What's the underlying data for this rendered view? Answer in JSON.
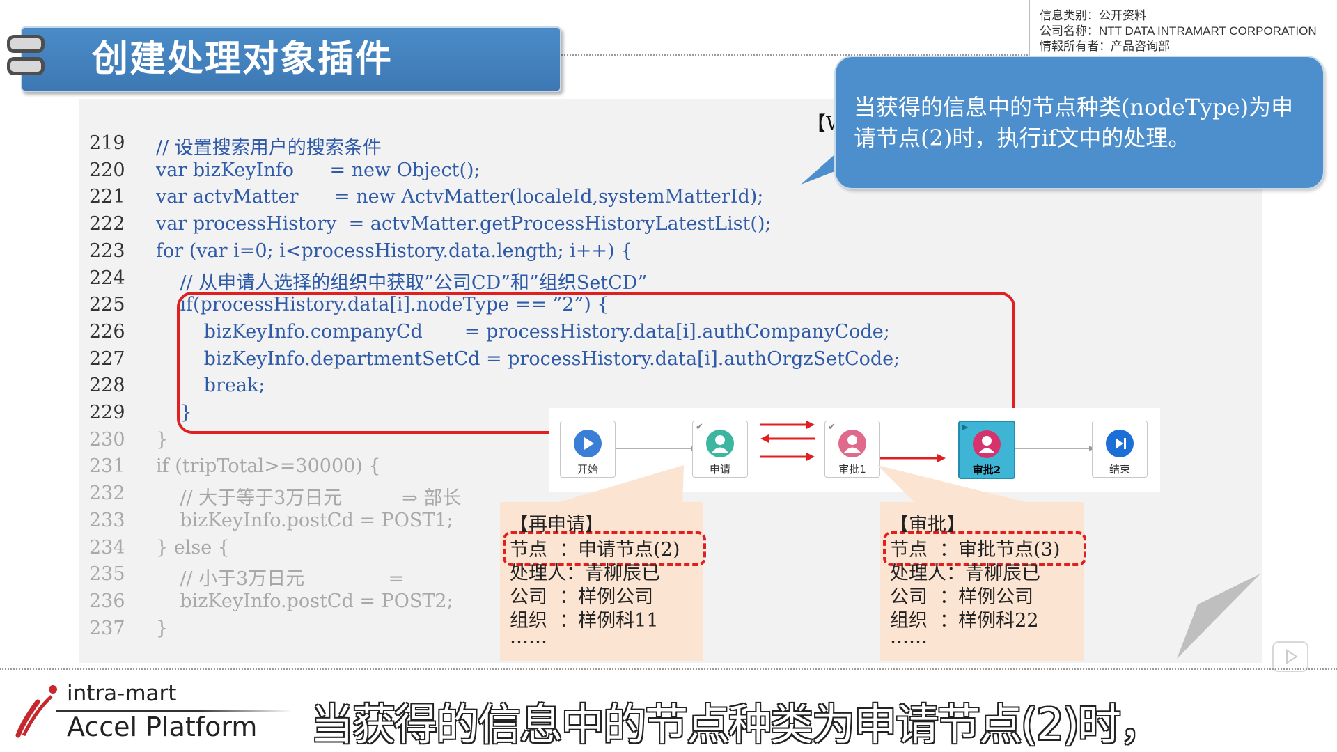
{
  "header": {
    "info_lines": [
      "信息类别：公开资料",
      "公司名称：NTT DATA INTRAMART CORPORATION",
      "情報所有者：产品咨询部"
    ],
    "title": "创建处理对象插件"
  },
  "callout": {
    "partial_label": "【Wo",
    "text": "当获得的信息中的节点种类(nodeType)为申请节点(2)时，执行if文中的处理。"
  },
  "code_lines": [
    {
      "n": "219",
      "code": "// 设置搜索用户的搜索条件"
    },
    {
      "n": "220",
      "code": "var bizKeyInfo      = new Object();"
    },
    {
      "n": "221",
      "code": "var actvMatter      = new ActvMatter(localeId,systemMatterId);"
    },
    {
      "n": "222",
      "code": "var processHistory  = actvMatter.getProcessHistoryLatestList();"
    },
    {
      "n": "223",
      "code": "for (var i=0; i<processHistory.data.length; i++) {"
    },
    {
      "n": "224",
      "code": "    // 从申请人选择的组织中获取”公司CD”和”组织SetCD”"
    },
    {
      "n": "225",
      "code": "    if(processHistory.data[i].nodeType == ”2”) {"
    },
    {
      "n": "226",
      "code": "        bizKeyInfo.companyCd       = processHistory.data[i].authCompanyCode;"
    },
    {
      "n": "227",
      "code": "        bizKeyInfo.departmentSetCd = processHistory.data[i].authOrgzSetCode;"
    },
    {
      "n": "228",
      "code": "        break;"
    },
    {
      "n": "229",
      "code": "    }"
    },
    {
      "n": "230",
      "code": "}"
    },
    {
      "n": "231",
      "code": "if (tripTotal>=30000) {"
    },
    {
      "n": "232",
      "code": "    // 大于等于3万日元          ⇒ 部长"
    },
    {
      "n": "233",
      "code": "    bizKeyInfo.postCd = POST1;"
    },
    {
      "n": "234",
      "code": "} else {"
    },
    {
      "n": "235",
      "code": "    // 小于3万日元              ="
    },
    {
      "n": "236",
      "code": "    bizKeyInfo.postCd = POST2;"
    },
    {
      "n": "237",
      "code": "}"
    }
  ],
  "flow": {
    "nodes": [
      {
        "label": "开始",
        "color": "#3a7fd5"
      },
      {
        "label": "申请",
        "color": "#3db6a0"
      },
      {
        "label": "审批1",
        "color": "#e06a8c"
      },
      {
        "label": "审批2",
        "color": "#d6336c"
      },
      {
        "label": "结束",
        "color": "#1d6fd8"
      }
    ]
  },
  "info_left": {
    "lines": [
      "【再申请】",
      "节点  ：申请节点(2)",
      "处理人：青柳辰已",
      "公司  ：样例公司",
      "组织  ：样例科11",
      "……"
    ]
  },
  "info_right": {
    "lines": [
      "【审批】",
      "节点  ：审批节点(3)",
      "处理人：青柳辰已",
      "公司  ：样例公司",
      "组织  ：样例科22",
      "……"
    ]
  },
  "footer": {
    "brand_line1": "intra-mart",
    "brand_line2": "Accel Platform",
    "subtitle": "当获得的信息中的节点种类为申请节点(2)时，"
  }
}
